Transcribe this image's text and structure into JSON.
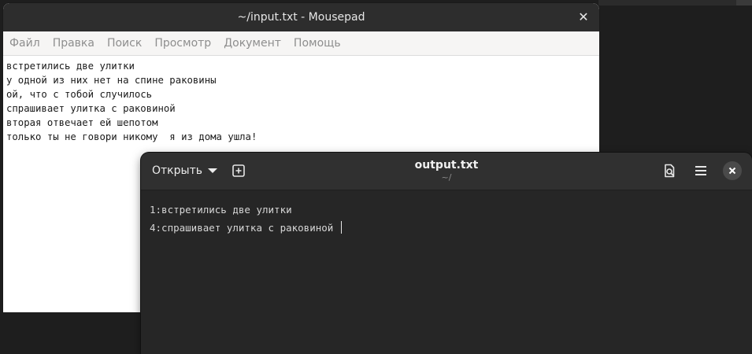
{
  "mousepad": {
    "title": "~/input.txt - Mousepad",
    "menu": [
      "Файл",
      "Правка",
      "Поиск",
      "Просмотр",
      "Документ",
      "Помощь"
    ],
    "lines": [
      "встретились две улитки",
      "у одной из них нет на спине раковины",
      "ой, что с тобой случилось",
      "спрашивает улитка с раковиной",
      "вторая отвечает ей шепотом",
      "только ты не говори никому  я из дома ушла!"
    ],
    "close_icon": "close-icon"
  },
  "output": {
    "open_label": "Открыть",
    "title": "output.txt",
    "subtitle": "~/",
    "lines": [
      "1:встретились две улитки",
      "4:спрашивает улитка с раковиной "
    ],
    "icons": {
      "open_menu": "chevron-down-icon",
      "new_tab": "new-tab-icon",
      "search": "search-document-icon",
      "hamburger": "hamburger-menu-icon",
      "close": "close-icon"
    },
    "colors": {
      "header_bg": "#303030",
      "editor_bg": "#262626",
      "text": "#d6d6d6"
    }
  }
}
